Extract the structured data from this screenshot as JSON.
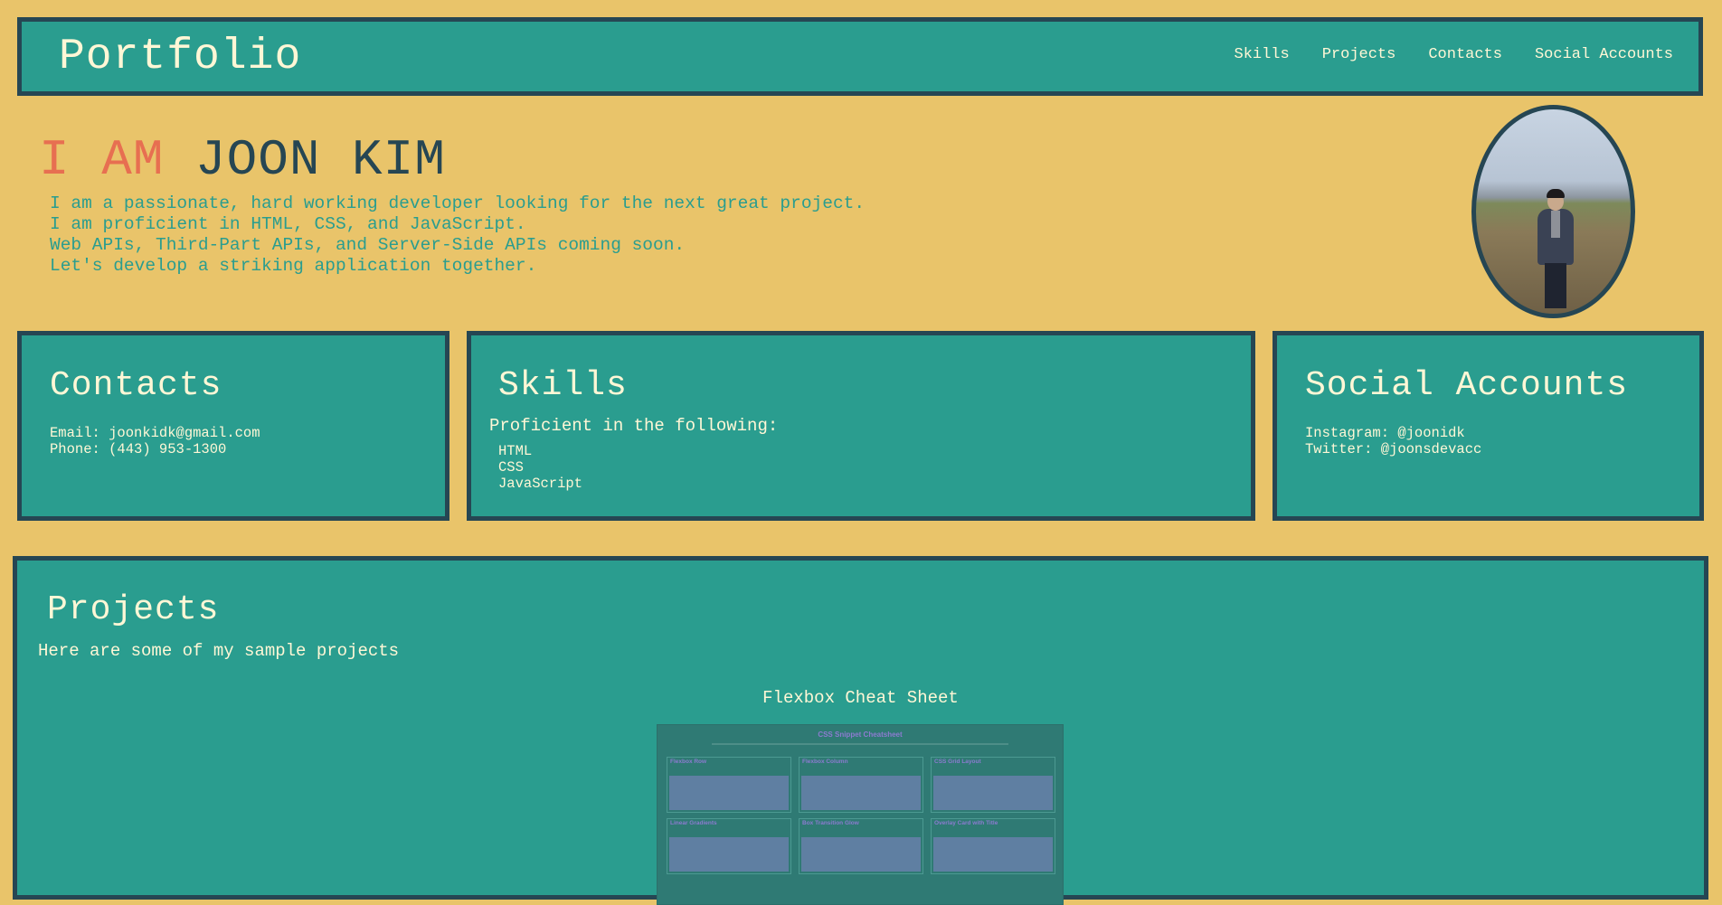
{
  "header": {
    "brand": "Portfolio",
    "nav": [
      "Skills",
      "Projects",
      "Contacts",
      "Social Accounts"
    ]
  },
  "hero": {
    "lead": "I AM",
    "name": "JOON KIM",
    "bio": [
      "I am a passionate, hard working developer looking for the next great project.",
      "I am proficient in HTML, CSS, and JavaScript.",
      "Web APIs, Third-Part APIs, and Server-Side APIs coming soon.",
      "Let's develop a striking application together."
    ]
  },
  "contacts": {
    "title": "Contacts",
    "email": "Email: joonkidk@gmail.com",
    "phone": "Phone: (443) 953-1300"
  },
  "skills": {
    "title": "Skills",
    "intro": "Proficient in the following:",
    "items": [
      "HTML",
      "CSS",
      "JavaScript"
    ]
  },
  "social": {
    "title": "Social Accounts",
    "instagram": "Instagram: @joonidk",
    "twitter": "Twitter: @joonsdevacc"
  },
  "projects": {
    "title": "Projects",
    "intro": "Here are some of my sample projects",
    "items": [
      {
        "title": "Flexbox Cheat Sheet",
        "thumbnail": {
          "heading": "CSS Snippet Cheatsheet",
          "cells": [
            "Flexbox Row",
            "Flexbox Column",
            "CSS Grid Layout",
            "Linear Gradients",
            "Box Transition Glow",
            "Overlay Card with Title"
          ]
        }
      }
    ]
  },
  "colors": {
    "background": "#E9C46A",
    "panel": "#2A9D8F",
    "border": "#264653",
    "accent": "#E76F51",
    "text_light": "#FFF7D6"
  }
}
